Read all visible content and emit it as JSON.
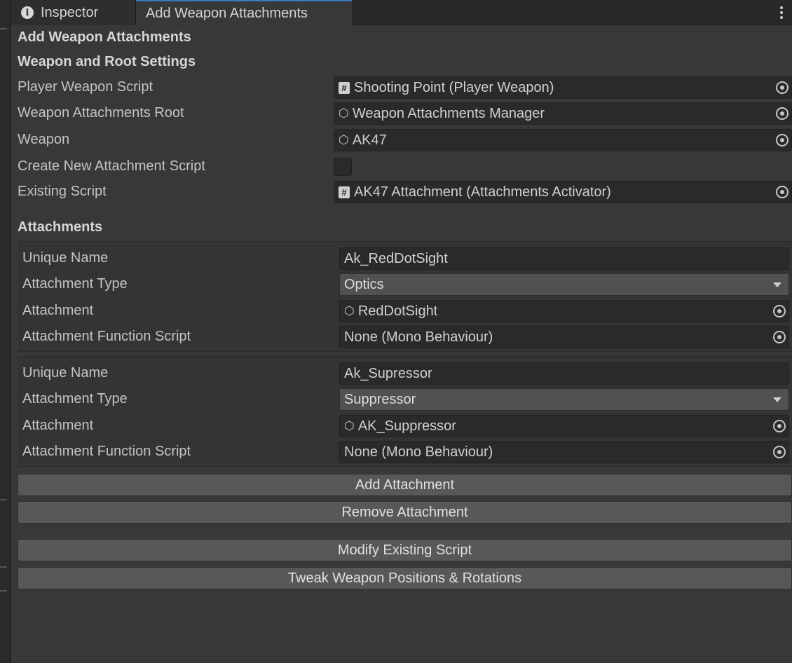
{
  "tabs": [
    {
      "label": "Inspector",
      "icon": "info-icon"
    },
    {
      "label": "Add Weapon Attachments"
    }
  ],
  "panel": {
    "title": "Add Weapon Attachments",
    "weapon_section": {
      "header": "Weapon and Root Settings",
      "player_weapon_script": {
        "label": "Player Weapon Script",
        "value": "Shooting Point (Player Weapon)"
      },
      "weapon_attachments_root": {
        "label": "Weapon Attachments Root",
        "value": "Weapon Attachments Manager"
      },
      "weapon": {
        "label": "Weapon",
        "value": "AK47"
      },
      "create_new_script": {
        "label": "Create New Attachment Script",
        "checked": false
      },
      "existing_script": {
        "label": "Existing Script",
        "value": "AK47 Attachment (Attachments Activator)"
      }
    },
    "attachments": {
      "header": "Attachments",
      "items": [
        {
          "unique_name_label": "Unique Name",
          "unique_name": "Ak_RedDotSight",
          "type_label": "Attachment Type",
          "type": "Optics",
          "attachment_label": "Attachment",
          "attachment": "RedDotSight",
          "function_label": "Attachment Function Script",
          "function": "None (Mono Behaviour)"
        },
        {
          "unique_name_label": "Unique Name",
          "unique_name": "Ak_Supressor",
          "type_label": "Attachment Type",
          "type": "Suppressor",
          "attachment_label": "Attachment",
          "attachment": "AK_Suppressor",
          "function_label": "Attachment Function Script",
          "function": "None (Mono Behaviour)"
        }
      ]
    },
    "buttons": {
      "add": "Add Attachment",
      "remove": "Remove Attachment",
      "modify": "Modify Existing Script",
      "tweak": "Tweak Weapon Positions & Rotations"
    }
  },
  "icons": {
    "script": "#",
    "object": "⬡"
  },
  "colors": {
    "background": "#383838",
    "field": "#2a2a2a",
    "button": "#585858",
    "tab_accent": "#3a79bb"
  }
}
